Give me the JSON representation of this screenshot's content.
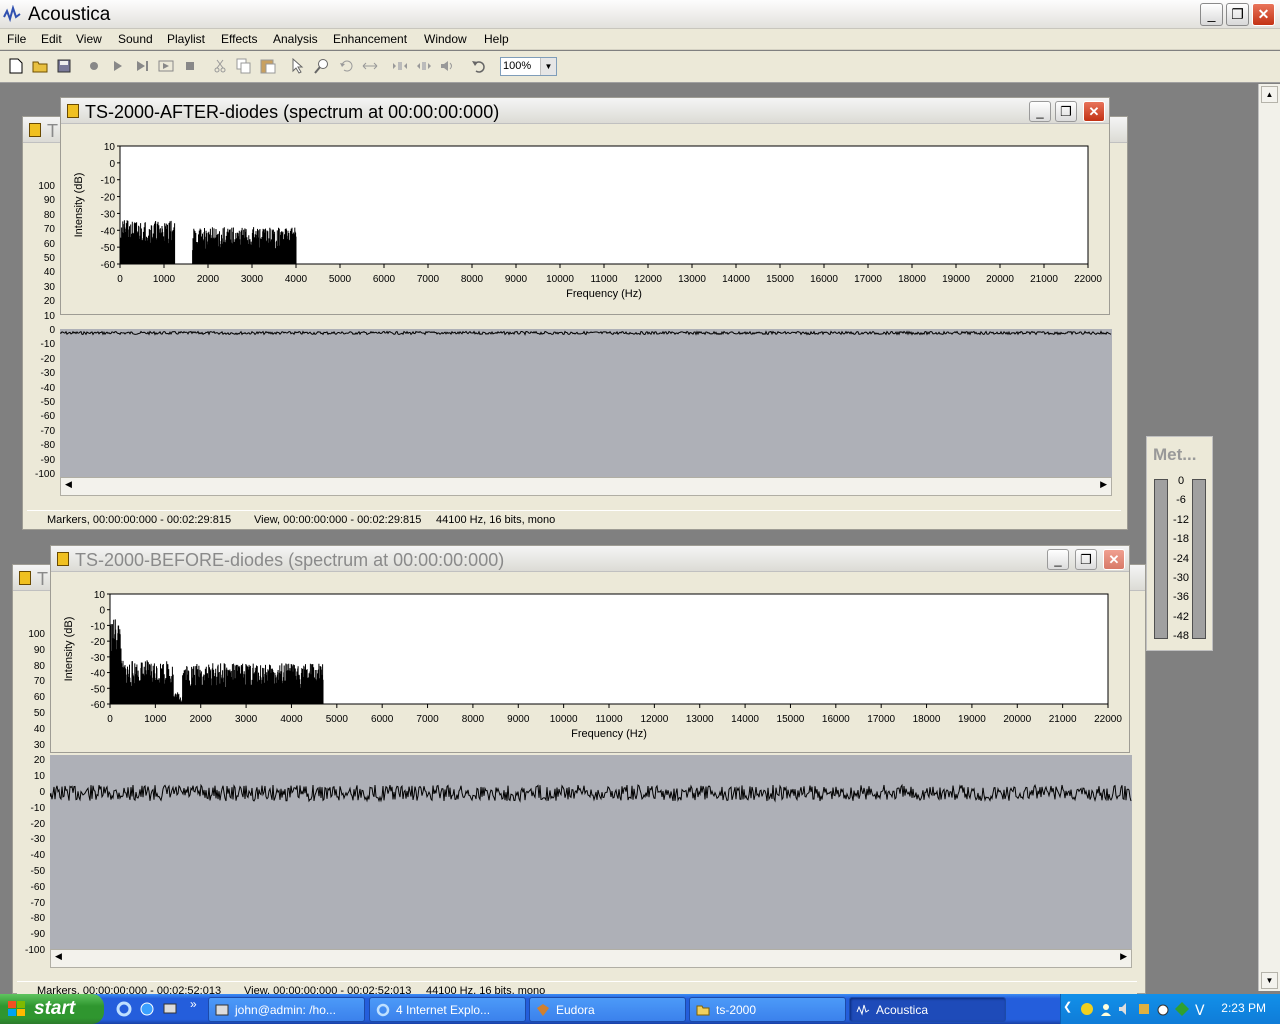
{
  "app": {
    "title": "Acoustica"
  },
  "menu": [
    "File",
    "Edit",
    "View",
    "Sound",
    "Playlist",
    "Effects",
    "Analysis",
    "Enhancement",
    "Window",
    "Help"
  ],
  "toolbar": {
    "zoom": "100%",
    "icons": [
      "new-icon",
      "open-icon",
      "save-icon",
      "record-icon",
      "play-icon",
      "play-selection-icon",
      "play-loop-icon",
      "stop-icon",
      "cut-icon",
      "copy-icon",
      "paste-icon",
      "select-icon",
      "zoom-icon",
      "undo-zoom-icon",
      "zoom-fit-icon",
      "zoom-in-icon",
      "zoom-out-icon",
      "volume-icon",
      "undo-icon"
    ]
  },
  "window_controls": {
    "minimize": "_",
    "restore": "❐",
    "close": "✕"
  },
  "spectrum_after": {
    "title": "TS-2000-AFTER-diodes (spectrum at 00:00:00:000)",
    "ylabel": "Intensity (dB)",
    "xlabel": "Frequency (Hz)",
    "yticks": [
      "10",
      "0",
      "-10",
      "-20",
      "-30",
      "-40",
      "-50",
      "-60"
    ],
    "xticks": [
      "0",
      "1000",
      "2000",
      "3000",
      "4000",
      "5000",
      "6000",
      "7000",
      "8000",
      "9000",
      "10000",
      "11000",
      "12000",
      "13000",
      "14000",
      "15000",
      "16000",
      "17000",
      "18000",
      "19000",
      "20000",
      "21000",
      "22000"
    ]
  },
  "spectrum_before": {
    "title": "TS-2000-BEFORE-diodes (spectrum at 00:00:00:000)",
    "ylabel": "Intensity (dB)",
    "xlabel": "Frequency (Hz)",
    "yticks": [
      "10",
      "0",
      "-10",
      "-20",
      "-30",
      "-40",
      "-50",
      "-60"
    ],
    "xticks": [
      "0",
      "1000",
      "2000",
      "3000",
      "4000",
      "5000",
      "6000",
      "7000",
      "8000",
      "9000",
      "10000",
      "11000",
      "12000",
      "13000",
      "14000",
      "15000",
      "16000",
      "17000",
      "18000",
      "19000",
      "20000",
      "21000",
      "22000"
    ]
  },
  "wave_after": {
    "title_fragment": "T",
    "yticks": [
      "100",
      "90",
      "80",
      "70",
      "60",
      "50",
      "40",
      "30",
      "20",
      "10",
      "0",
      "-10",
      "-20",
      "-30",
      "-40",
      "-50",
      "-60",
      "-70",
      "-80",
      "-90",
      "-100"
    ],
    "status_markers": "Markers, 00:00:00:000 - 00:02:29:815",
    "status_view": "View, 00:00:00:000 - 00:02:29:815",
    "status_format": "44100 Hz, 16 bits, mono"
  },
  "wave_before": {
    "title_fragment": "T",
    "yticks": [
      "100",
      "90",
      "80",
      "70",
      "60",
      "50",
      "40",
      "30",
      "20",
      "10",
      "0",
      "-10",
      "-20",
      "-30",
      "-40",
      "-50",
      "-60",
      "-70",
      "-80",
      "-90",
      "-100"
    ],
    "status_markers": "Markers, 00:00:00:000 - 00:02:52:013",
    "status_view": "View, 00:00:00:000 - 00:02:52:013",
    "status_format": "44100 Hz, 16 bits, mono"
  },
  "meter": {
    "title": "Met...",
    "labels": [
      "0",
      "-6",
      "-12",
      "-18",
      "-24",
      "-30",
      "-36",
      "-42",
      "-48"
    ]
  },
  "taskbar": {
    "start": "start",
    "tasks": [
      {
        "label": "john@admin: /ho...",
        "icon": "terminal-icon"
      },
      {
        "label": "4 Internet Explo...",
        "icon": "ie-icon"
      },
      {
        "label": "Eudora",
        "icon": "eudora-icon"
      },
      {
        "label": "ts-2000",
        "icon": "folder-icon"
      },
      {
        "label": "Acoustica",
        "icon": "acoustica-icon"
      }
    ],
    "clock": "2:23 PM"
  },
  "colors": {
    "accent": "#245edc",
    "wave_bg": "#aeb0b7",
    "close": "#c33214"
  }
}
